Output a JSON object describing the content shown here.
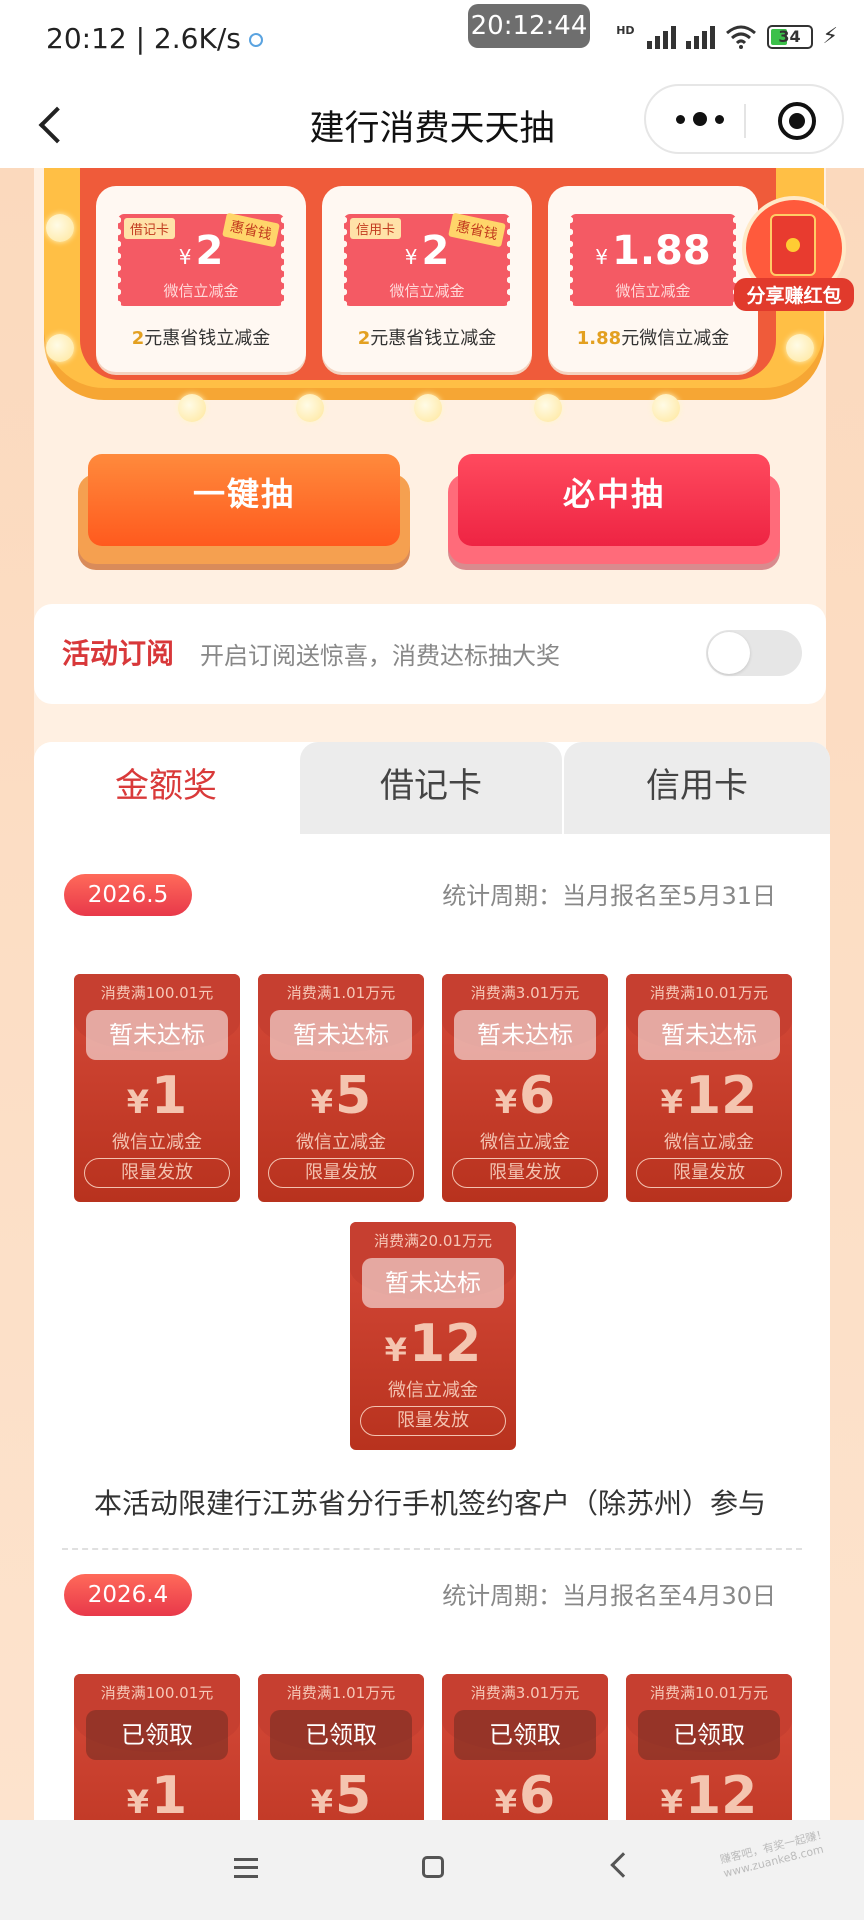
{
  "status_bar": {
    "left_text": "20:12 | 2.6K/s",
    "time_pill": "20:12:44",
    "hd": "HD",
    "battery": "34"
  },
  "nav": {
    "title": "建行消费天天抽"
  },
  "prize_machine": {
    "coupons": [
      {
        "tag": "借记卡",
        "ribbon": "惠省钱",
        "amount": "2",
        "sub": "微信立减金",
        "caption_amount": "2",
        "caption_text": "元惠省钱立减金"
      },
      {
        "tag": "信用卡",
        "ribbon": "惠省钱",
        "amount": "2",
        "sub": "微信立减金",
        "caption_amount": "2",
        "caption_text": "元惠省钱立减金"
      },
      {
        "tag": "",
        "ribbon": "",
        "amount": "1.88",
        "sub": "微信立减金",
        "caption_amount": "1.88",
        "caption_text": "元微信立减金"
      }
    ],
    "yen": "¥",
    "share_label": "分享赚红包"
  },
  "buttons": {
    "one_click": "一键抽",
    "sure_win": "必中抽"
  },
  "subscribe": {
    "title": "活动订阅",
    "desc": "开启订阅送惊喜，消费达标抽大奖",
    "enabled": false
  },
  "tabs": [
    "金额奖",
    "借记卡",
    "信用卡"
  ],
  "active_tab": 0,
  "periods": [
    {
      "badge": "2026.5",
      "cycle": "统计周期：当月报名至5月31日",
      "packs": [
        {
          "cond": "消费满100.01元",
          "status": "暂未达标",
          "amount": "1",
          "label": "微信立减金",
          "limit": "限量发放"
        },
        {
          "cond": "消费满1.01万元",
          "status": "暂未达标",
          "amount": "5",
          "label": "微信立减金",
          "limit": "限量发放"
        },
        {
          "cond": "消费满3.01万元",
          "status": "暂未达标",
          "amount": "6",
          "label": "微信立减金",
          "limit": "限量发放"
        },
        {
          "cond": "消费满10.01万元",
          "status": "暂未达标",
          "amount": "12",
          "label": "微信立减金",
          "limit": "限量发放"
        },
        {
          "cond": "消费满20.01万元",
          "status": "暂未达标",
          "amount": "12",
          "label": "微信立减金",
          "limit": "限量发放"
        }
      ],
      "notice": "本活动限建行江苏省分行手机签约客户（除苏州）参与"
    },
    {
      "badge": "2026.4",
      "cycle": "统计周期：当月报名至4月30日",
      "packs": [
        {
          "cond": "消费满100.01元",
          "status": "已领取",
          "amount": "1"
        },
        {
          "cond": "消费满1.01万元",
          "status": "已领取",
          "amount": "5"
        },
        {
          "cond": "消费满3.01万元",
          "status": "已领取",
          "amount": "6"
        },
        {
          "cond": "消费满10.01万元",
          "status": "已领取",
          "amount": "12"
        }
      ]
    }
  ],
  "watermark": "赚客吧，有奖一起赚！ www.zuanke8.com"
}
